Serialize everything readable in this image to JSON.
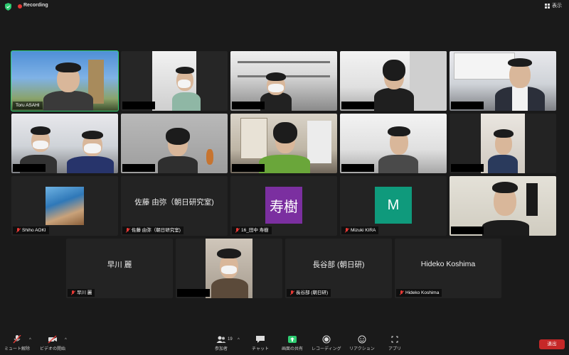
{
  "top": {
    "recording": "Recording",
    "view": "表示"
  },
  "tiles": {
    "t1": "Toru ASAHI",
    "shiho": "Shiho AOKI",
    "sato_center": "佐藤 由弥（朝日研究室)",
    "sato_label": "佐藤 由弥（朝日研究室)",
    "tanaka_avatar": "寿樹",
    "tanaka_label": "16_田中 寿樹",
    "kira_avatar": "M",
    "kira_label": "Mizuki KIRA",
    "hayakawa_center": "早川 麗",
    "hayakawa_label": "早川 麗",
    "hasebe_center": "長谷部 (朝日研)",
    "hasebe_label": "長谷部 (朝日研)",
    "koshima_center": "Hideko Koshima",
    "koshima_label": "Hideko Koshima"
  },
  "colors": {
    "tanaka_bg": "#7b2fa0",
    "kira_bg": "#0f9a7c",
    "active": "#2ecc71",
    "leave": "#c62828"
  },
  "toolbar": {
    "mute": "ミュート解除",
    "video": "ビデオの開始",
    "participants": "参加者",
    "participants_count": "19",
    "chat": "チャット",
    "share": "画面の共有",
    "record": "レコーディング",
    "reactions": "リアクション",
    "apps": "アプリ",
    "leave": "退出"
  }
}
